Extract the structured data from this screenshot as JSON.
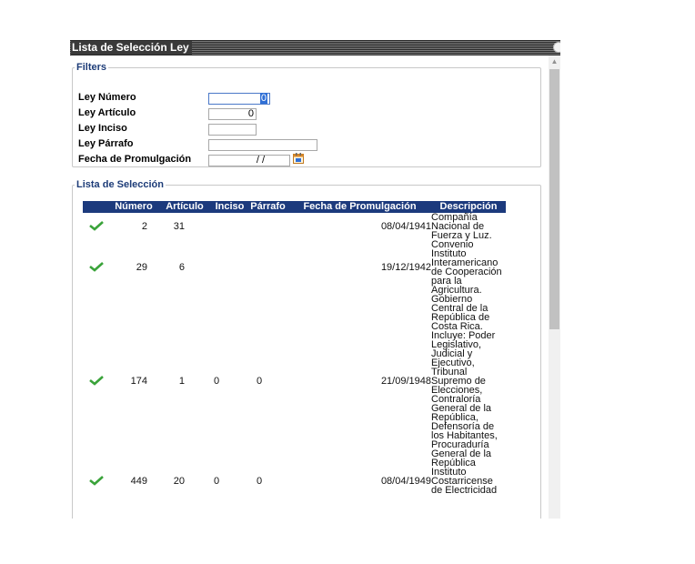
{
  "window": {
    "title": "Lista de Selección Ley"
  },
  "filters": {
    "legend": "Filters",
    "fields": [
      {
        "label": "Ley Número",
        "value": "0"
      },
      {
        "label": "Ley Artículo",
        "value": "0"
      },
      {
        "label": "Ley Inciso",
        "value": ""
      },
      {
        "label": "Ley Párrafo",
        "value": ""
      },
      {
        "label": "Fecha de Promulgación",
        "value": "/ /"
      }
    ]
  },
  "lista": {
    "legend": "Lista de Selección",
    "columns": [
      "Número",
      "Artículo",
      "Inciso",
      "Párrafo",
      "Fecha de Promulgación",
      "Descripción"
    ],
    "rows": [
      {
        "numero": "2",
        "articulo": "31",
        "inciso": "",
        "parrafo": "",
        "fecha": "08/04/1941",
        "descripcion": "Compañía Nacional de Fuerza y Luz."
      },
      {
        "numero": "29",
        "articulo": "6",
        "inciso": "",
        "parrafo": "",
        "fecha": "19/12/1942",
        "descripcion": "Convenio Instituto Interamericano de Cooperación para la Agricultura."
      },
      {
        "numero": "174",
        "articulo": "1",
        "inciso": "0",
        "parrafo": "0",
        "fecha": "21/09/1948",
        "descripcion": "Gobierno Central de la República de Costa Rica. Incluye: Poder Legislativo, Judicial y Ejecutivo, Tribunal Supremo de Elecciones, Contraloría General de la República, Defensoría de los Habitantes, Procuraduría General de la República"
      },
      {
        "numero": "449",
        "articulo": "20",
        "inciso": "0",
        "parrafo": "0",
        "fecha": "08/04/1949",
        "descripcion": "Instituto Costarricense de Electricidad"
      }
    ]
  },
  "icons": {
    "row_status": "checkmark-icon",
    "calendar": "calendar-icon",
    "close": "close-icon"
  },
  "colors": {
    "header_bg": "#1c3a7d",
    "legend_text": "#1d3c78",
    "check": "#3aa33a"
  }
}
